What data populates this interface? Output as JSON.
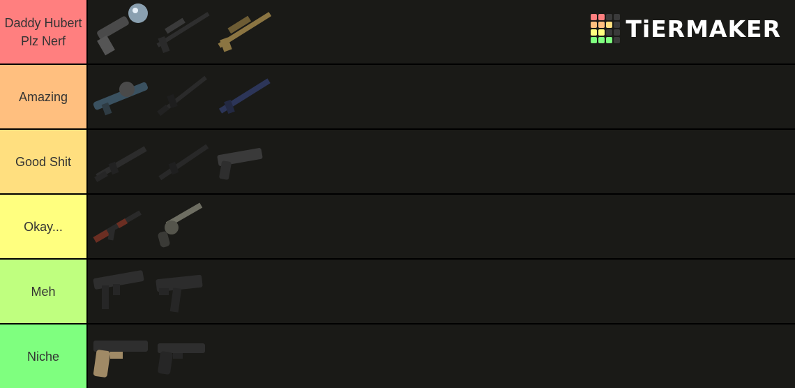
{
  "logo": {
    "text": "TiERMAKER",
    "grid_colors": [
      "#ff7f7f",
      "#ff7f7f",
      "#3a3a3a",
      "#3a3a3a",
      "#ffbf7f",
      "#ffbf7f",
      "#ffdf7f",
      "#3a3a3a",
      "#ffff7f",
      "#ffff7f",
      "#3a3a3a",
      "#3a3a3a",
      "#7fff7f",
      "#7fff7f",
      "#7fff7f",
      "#3a3a3a"
    ]
  },
  "tiers": [
    {
      "label": "Daddy Hubert Plz Nerf",
      "color": "#ff7f7f",
      "items": [
        "flare-launcher-icon",
        "sniper-rifle-icon",
        "tan-marksman-rifle-icon"
      ]
    },
    {
      "label": "Amazing",
      "color": "#ffbf7f",
      "items": [
        "blue-launcher-icon",
        "assault-rifle-icon",
        "blue-rifle-icon"
      ]
    },
    {
      "label": "Good Shit",
      "color": "#ffdf7f",
      "items": [
        "carbine-icon",
        "dmr-rifle-icon",
        "pistol-icon"
      ]
    },
    {
      "label": "Okay...",
      "color": "#ffff7f",
      "items": [
        "ak-rifle-icon",
        "revolver-icon"
      ]
    },
    {
      "label": "Meh",
      "color": "#bfff7f",
      "items": [
        "smg-icon",
        "machine-pistol-icon"
      ]
    },
    {
      "label": "Niche",
      "color": "#7fff7f",
      "items": [
        "tan-pistol-icon",
        "black-pistol-icon"
      ]
    }
  ]
}
